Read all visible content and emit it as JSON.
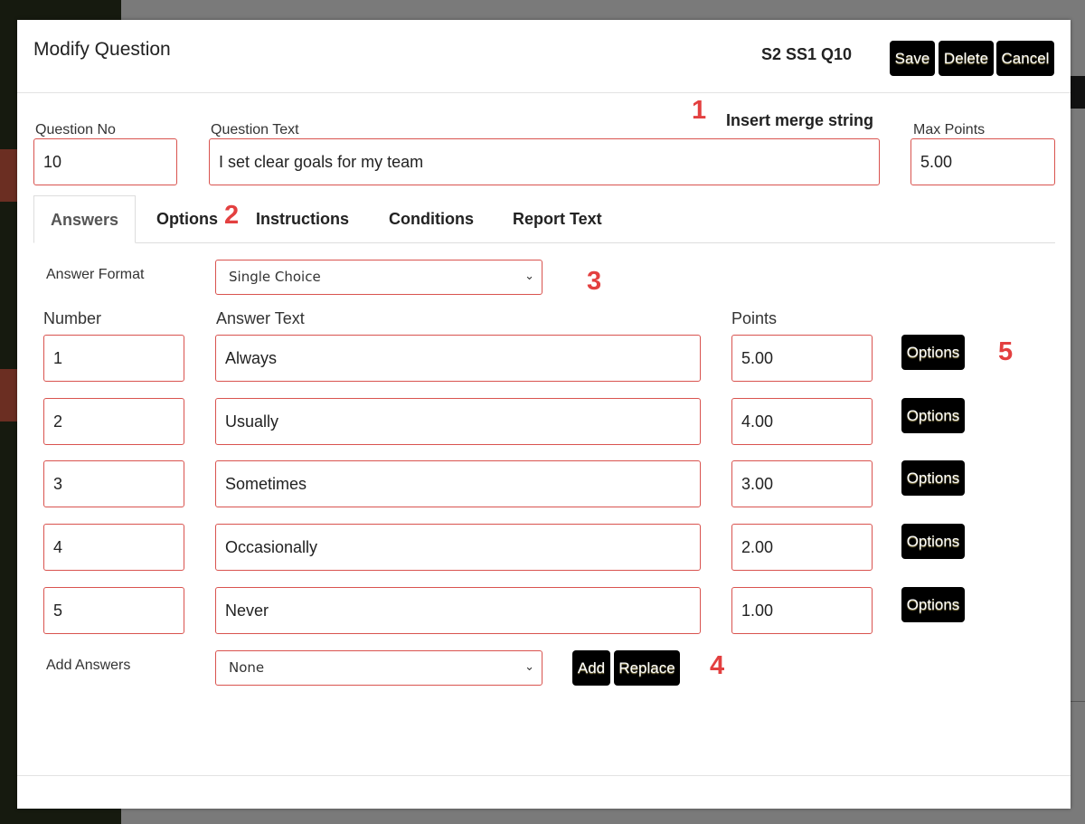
{
  "dialog": {
    "title": "Modify Question",
    "question_code": "S2 SS1 Q10",
    "buttons": {
      "save": "Save",
      "delete": "Delete",
      "cancel": "Cancel"
    }
  },
  "fields": {
    "question_no_label": "Question No",
    "question_no": "10",
    "question_text_label": "Question Text",
    "question_text": "I set clear goals for my team",
    "insert_merge_string": "Insert merge string",
    "max_points_label": "Max Points",
    "max_points": "5.00"
  },
  "tabs": [
    {
      "label": "Answers",
      "active": true
    },
    {
      "label": "Options"
    },
    {
      "label": "Instructions"
    },
    {
      "label": "Conditions"
    },
    {
      "label": "Report Text"
    }
  ],
  "answers_tab": {
    "answer_format_label": "Answer Format",
    "answer_format": "Single Choice",
    "col_number": "Number",
    "col_answer_text": "Answer Text",
    "col_points": "Points",
    "rows": [
      {
        "number": "1",
        "text": "Always",
        "points": "5.00",
        "options": "Options"
      },
      {
        "number": "2",
        "text": "Usually",
        "points": "4.00",
        "options": "Options"
      },
      {
        "number": "3",
        "text": "Sometimes",
        "points": "3.00",
        "options": "Options"
      },
      {
        "number": "4",
        "text": "Occasionally",
        "points": "2.00",
        "options": "Options"
      },
      {
        "number": "5",
        "text": "Never",
        "points": "1.00",
        "options": "Options"
      }
    ],
    "add_answers_label": "Add Answers",
    "add_answers_value": "None",
    "add_button": "Add",
    "replace_button": "Replace"
  },
  "annotations": [
    "1",
    "2",
    "3",
    "4",
    "5"
  ],
  "colors": {
    "accent_border": "#d9534f",
    "annotation": "#e34040",
    "button_bg": "#000000"
  }
}
